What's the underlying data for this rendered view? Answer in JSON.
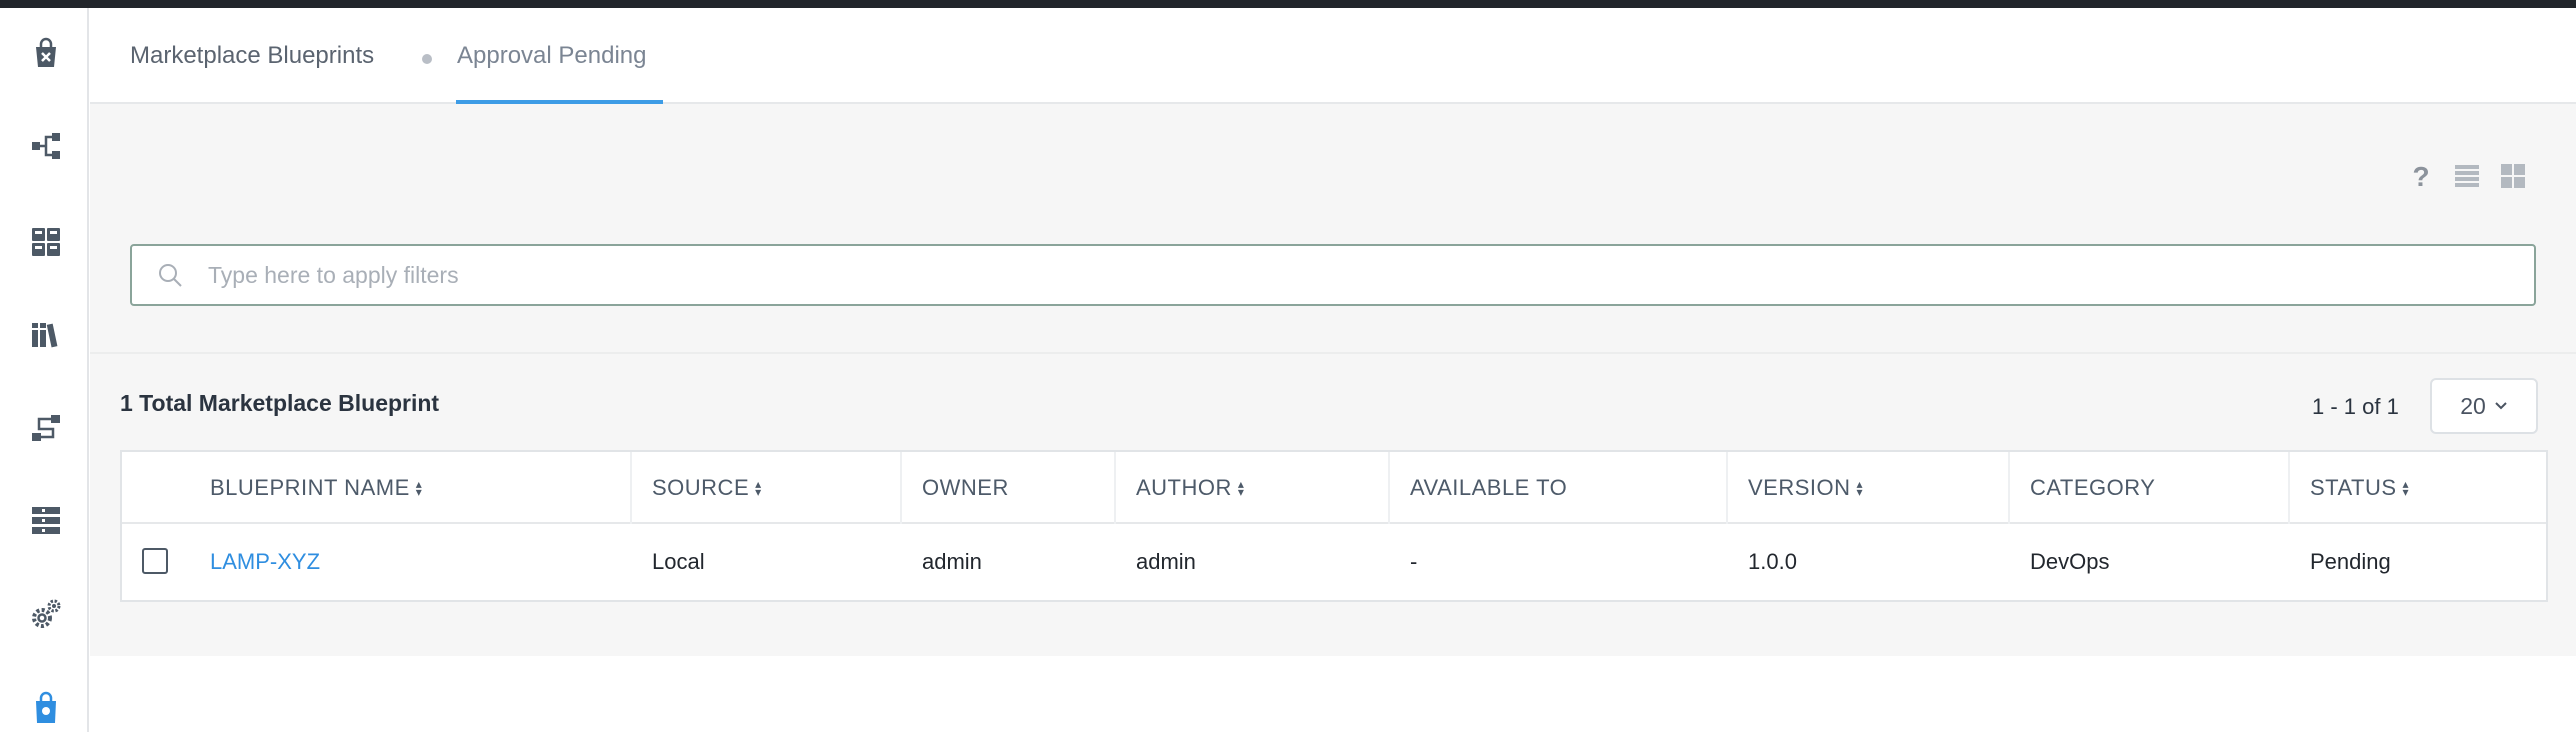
{
  "sidebar": {
    "items": [
      {
        "name": "marketplace-icon"
      },
      {
        "name": "blueprints-icon"
      },
      {
        "name": "applications-icon"
      },
      {
        "name": "library-icon"
      },
      {
        "name": "runbooks-icon"
      },
      {
        "name": "endpoints-icon"
      },
      {
        "name": "settings-icon"
      },
      {
        "name": "marketplace-manager-icon"
      }
    ]
  },
  "tabs": [
    {
      "label": "Marketplace Blueprints"
    },
    {
      "label": "Approval Pending"
    }
  ],
  "toolbar": {
    "icons": [
      "help-icon",
      "list-view-icon",
      "grid-view-icon"
    ]
  },
  "filter": {
    "placeholder": "Type here to apply filters"
  },
  "summary": {
    "total": "1 Total Marketplace Blueprint",
    "range": "1 - 1 of 1",
    "page_size": "20"
  },
  "table": {
    "headers": [
      "BLUEPRINT NAME",
      "SOURCE",
      "OWNER",
      "AUTHOR",
      "AVAILABLE TO",
      "VERSION",
      "CATEGORY",
      "STATUS"
    ],
    "rows": [
      {
        "name": "LAMP-XYZ",
        "source": "Local",
        "owner": "admin",
        "author": "admin",
        "available_to": "-",
        "version": "1.0.0",
        "category": "DevOps",
        "status": "Pending"
      }
    ]
  },
  "colors": {
    "accent": "#3d9ce6",
    "link": "#2f8ee0",
    "sidebar_icon": "#4d5966"
  }
}
